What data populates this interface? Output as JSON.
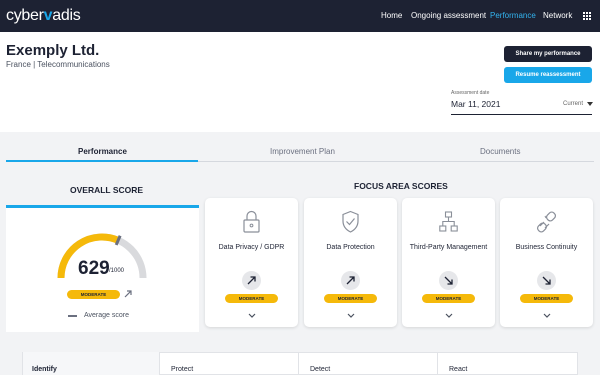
{
  "nav": {
    "logo_left": "cyber",
    "logo_mid": "v",
    "logo_right": "adis",
    "items": [
      "Home",
      "Ongoing assessment",
      "Performance",
      "Network"
    ]
  },
  "header": {
    "company": "Exemply Ltd.",
    "subtitle": "France | Telecommunications",
    "share_button": "Share my performance",
    "resume_button": "Resume reassessment",
    "assessment_label": "Assessment date",
    "assessment_date": "Mar 11, 2021",
    "assessment_selector": "Current"
  },
  "tabs": [
    "Performance",
    "Improvement Plan",
    "Documents"
  ],
  "overall": {
    "title": "OVERALL SCORE",
    "score": "629",
    "max": "/1000",
    "score_fraction": 0.629,
    "level": "MODERATE",
    "average_label": "Average score"
  },
  "focus": {
    "title": "FOCUS AREA SCORES",
    "areas": [
      {
        "name": "Data Privacy / GDPR",
        "level": "MODERATE",
        "icon": "lock-icon",
        "trend": "up"
      },
      {
        "name": "Data Protection",
        "level": "MODERATE",
        "icon": "shield-check-icon",
        "trend": "up"
      },
      {
        "name": "Third-Party Management",
        "level": "MODERATE",
        "icon": "network-icon",
        "trend": "down"
      },
      {
        "name": "Business Continuity",
        "level": "MODERATE",
        "icon": "broken-link-icon",
        "trend": "down"
      }
    ]
  },
  "bottom_columns": [
    "Identify",
    "Protect",
    "Detect",
    "React"
  ],
  "colors": {
    "navy": "#1d2233",
    "accent_blue": "#19a7e9",
    "moderate_yellow": "#f5b90a",
    "gauge_track": "#d9dadd"
  }
}
